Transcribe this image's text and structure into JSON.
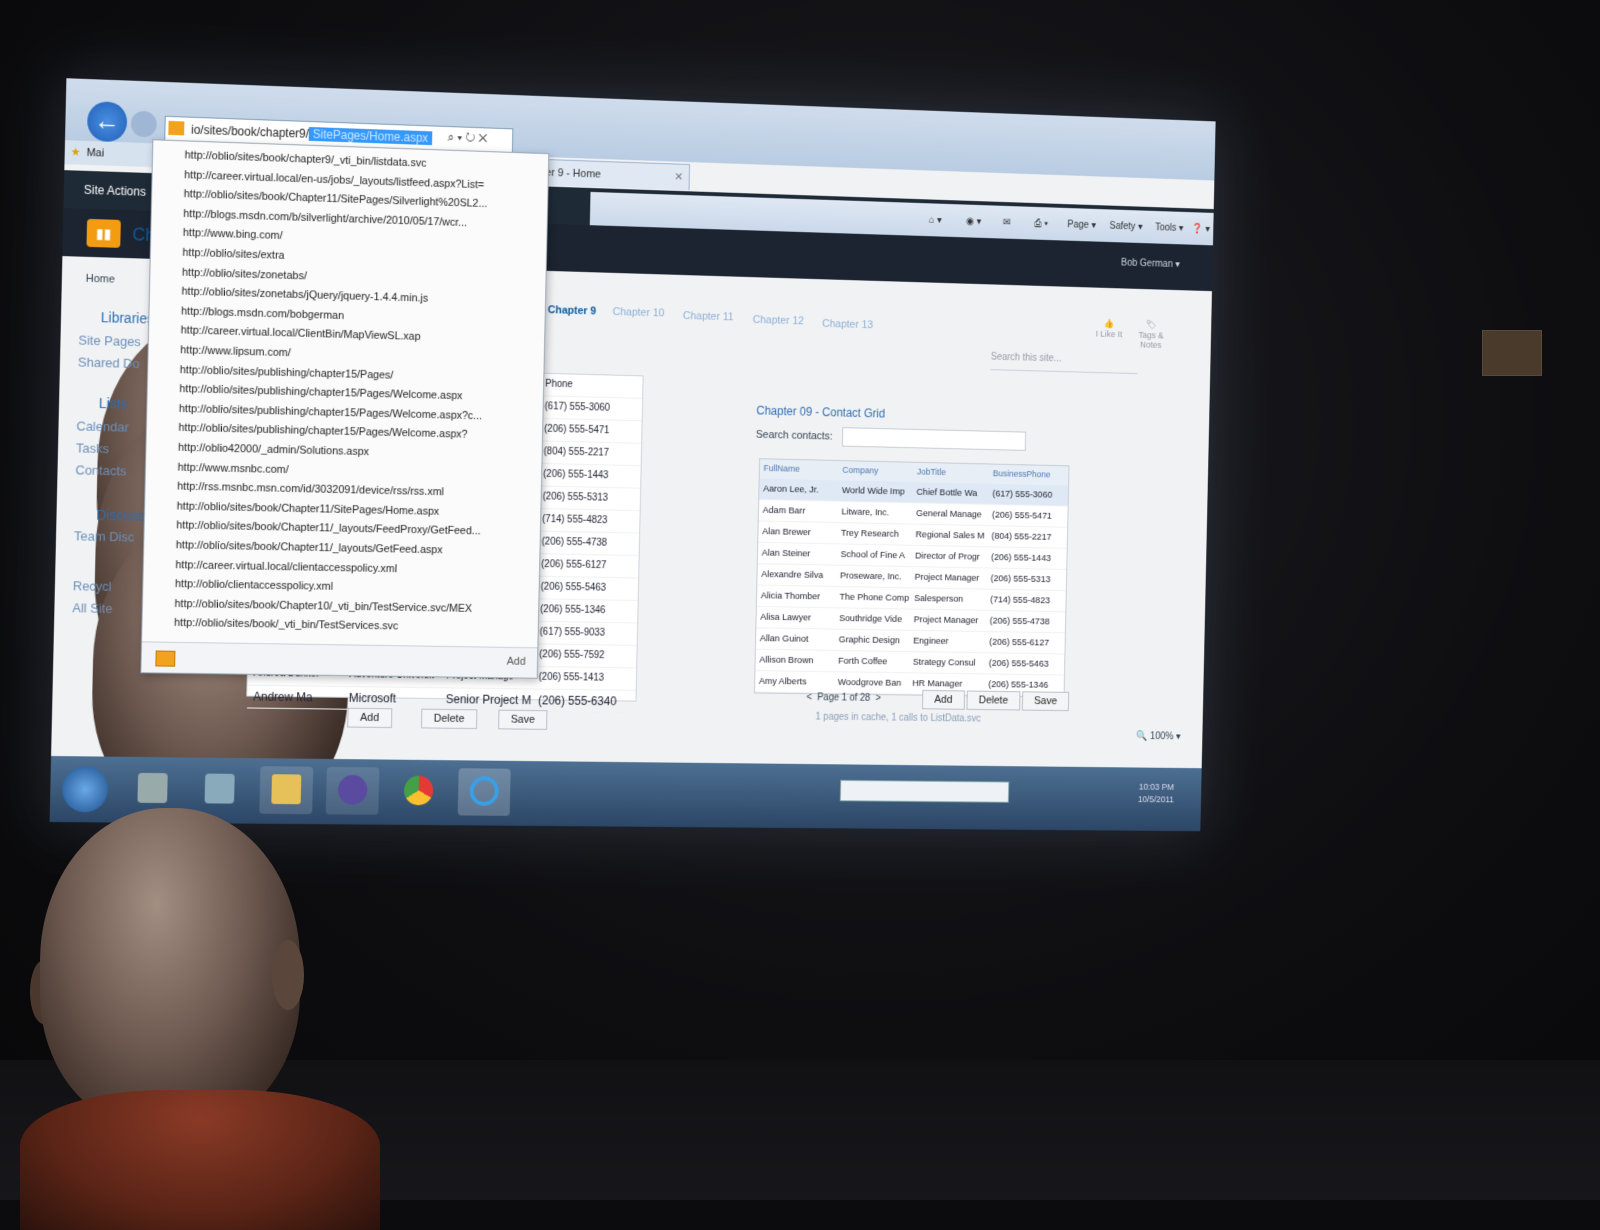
{
  "browser": {
    "address": "io/sites/book/chapter9/",
    "address_selected": "SitePages/Home.aspx",
    "tab_title": "Chapter 9 - Home",
    "favorites": "Mai",
    "commands": [
      "Page ▾",
      "Safety ▾",
      "Tools ▾"
    ]
  },
  "autocomplete": {
    "items": [
      "http://oblio/sites/book/chapter9/_vti_bin/listdata.svc",
      "http://career.virtual.local/en-us/jobs/_layouts/listfeed.aspx?List=",
      "http://oblio/sites/book/Chapter11/SitePages/Silverlight%20SL2...",
      "http://blogs.msdn.com/b/silverlight/archive/2010/05/17/wcr...",
      "http://www.bing.com/",
      "http://oblio/sites/extra",
      "http://oblio/sites/zonetabs/",
      "http://oblio/sites/zonetabs/jQuery/jquery-1.4.4.min.js",
      "http://blogs.msdn.com/bobgerman",
      "http://career.virtual.local/ClientBin/MapViewSL.xap",
      "http://www.lipsum.com/",
      "http://oblio/sites/publishing/chapter15/Pages/",
      "http://oblio/sites/publishing/chapter15/Pages/Welcome.aspx",
      "http://oblio/sites/publishing/chapter15/Pages/Welcome.aspx?c...",
      "http://oblio/sites/publishing/chapter15/Pages/Welcome.aspx?",
      "http://oblio42000/_admin/Solutions.aspx",
      "http://www.msnbc.com/",
      "http://rss.msnbc.msn.com/id/3032091/device/rss/rss.xml",
      "http://oblio/sites/book/Chapter11/SitePages/Home.aspx",
      "http://oblio/sites/book/Chapter11/_layouts/FeedProxy/GetFeed...",
      "http://oblio/sites/book/Chapter11/_layouts/GetFeed.aspx",
      "http://career.virtual.local/clientaccesspolicy.xml",
      "http://oblio/clientaccesspolicy.xml",
      "http://oblio/sites/book/Chapter10/_vti_bin/TestService.svc/MEX",
      "http://oblio/sites/book/_vti_bin/TestServices.svc"
    ],
    "add_label": "Add"
  },
  "sharepoint": {
    "site_actions": "Site Actions",
    "user": "Bob German ▾",
    "site_title_fragment": "Ch",
    "logo_glyph": "▮▮",
    "nav": {
      "home": "Home",
      "tabs": [
        "Chapter 9",
        "Chapter 10",
        "Chapter 11",
        "Chapter 12",
        "Chapter 13"
      ]
    },
    "search_placeholder": "Search this site...",
    "ribbon_buttons": [
      "I Like It",
      "Tags & Notes"
    ],
    "quick_launch": [
      {
        "label": "Libraries",
        "head": true
      },
      {
        "label": "Site Pages",
        "head": false
      },
      {
        "label": "Shared Do",
        "head": false
      },
      {
        "label": "Lists",
        "head": true
      },
      {
        "label": "Calendar",
        "head": false
      },
      {
        "label": "Tasks",
        "head": false
      },
      {
        "label": "Contacts",
        "head": false
      },
      {
        "label": "Discussio",
        "head": true
      },
      {
        "label": "Team Disc",
        "head": false
      },
      {
        "label": "Recycl",
        "head": false
      },
      {
        "label": "All Site",
        "head": false
      }
    ]
  },
  "left_grid": {
    "phone_header": "Phone",
    "phones": [
      "(617) 555-3060",
      "(206) 555-5471",
      "(804) 555-2217",
      "(206) 555-1443",
      "(206) 555-5313",
      "(714) 555-4823",
      "(206) 555-4738",
      "(206) 555-6127",
      "(206) 555-5463",
      "(206) 555-1346",
      "(617) 555-9033",
      "(206) 555-7592",
      "(206) 555-1413"
    ],
    "partial_row": [
      "Andrea Dunker",
      "Adventure Universit",
      "Project Manage",
      "(206) 555-1413"
    ],
    "last_row": [
      "Andrew Ma",
      "Microsoft",
      "Senior Project M",
      "(206) 555-6340"
    ],
    "buttons": [
      "Add",
      "Delete",
      "Save"
    ]
  },
  "contact_grid": {
    "title": "Chapter 09 - Contact Grid",
    "search_label": "Search contacts:",
    "headers": [
      "FullName",
      "Company",
      "JobTitle",
      "BusinessPhone"
    ],
    "rows": [
      [
        "Aaron Lee, Jr.",
        "World Wide Imp",
        "Chief Bottle Wa",
        "(617) 555-3060"
      ],
      [
        "Adam Barr",
        "Litware, Inc.",
        "General Manage",
        "(206) 555-5471"
      ],
      [
        "Alan Brewer",
        "Trey Research",
        "Regional Sales M",
        "(804) 555-2217"
      ],
      [
        "Alan Steiner",
        "School of Fine A",
        "Director of Progr",
        "(206) 555-1443"
      ],
      [
        "Alexandre Silva",
        "Proseware, Inc.",
        "Project Manager",
        "(206) 555-5313"
      ],
      [
        "Alicia Thomber",
        "The Phone Comp",
        "Salesperson",
        "(714) 555-4823"
      ],
      [
        "Alisa Lawyer",
        "Southridge Vide",
        "Project Manager",
        "(206) 555-4738"
      ],
      [
        "Allan Guinot",
        "Graphic Design",
        "Engineer",
        "(206) 555-6127"
      ],
      [
        "Allison Brown",
        "Forth Coffee",
        "Strategy Consul",
        "(206) 555-5463"
      ],
      [
        "Amy Alberts",
        "Woodgrove Ban",
        "HR Manager",
        "(206) 555-1346"
      ]
    ],
    "pager": "Page 1 of 28",
    "buttons": [
      "Add",
      "Delete",
      "Save"
    ],
    "status": "1 pages in cache, 1 calls to ListData.svc"
  },
  "status_bar": {
    "zoom": "100%"
  },
  "taskbar": {
    "clock_time": "10:03 PM",
    "clock_date": "10/5/2011"
  },
  "colors": {
    "accent": "#2f6db2",
    "sp_orange": "#f39c12",
    "taskbar": "#2c4666"
  }
}
